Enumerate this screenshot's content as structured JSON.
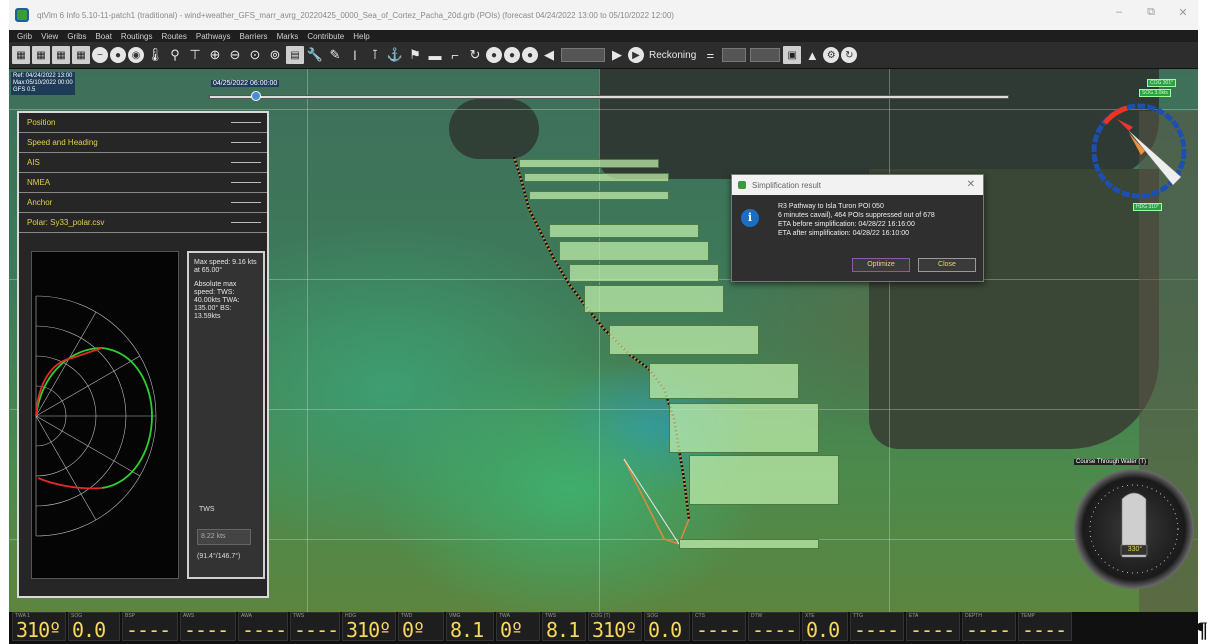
{
  "window": {
    "title": "qtVlm 6 Info 5.10-11-patch1 (traditional) - wind+weather_GFS_marr_avrg_20220425_0000_Sea_of_Cortez_Pacha_20d.grb (POIs) (forecast 04/24/2022 13:00 to 05/10/2022 12:00)",
    "minimize": "–",
    "maximize": "⧉",
    "close": "✕"
  },
  "menu": [
    "Grib",
    "View",
    "Gribs",
    "Boat",
    "Routings",
    "Routes",
    "Pathways",
    "Barriers",
    "Marks",
    "Contribute",
    "Help"
  ],
  "toolbar": {
    "reckoning_label": "Reckoning",
    "date_field": "",
    "step_field": "",
    "zoom_field": ""
  },
  "map_info": {
    "line1": "Ref: 04/24/2022 13:00",
    "line2": "Max:05/10/2022 00:00",
    "line3": "GFS 0.5",
    "timeline_date": "04/25/2022 06:00:00"
  },
  "dock": {
    "items": [
      "Position",
      "Speed and Heading",
      "AIS",
      "NMEA",
      "Anchor",
      "Polar: Sy33_polar.csv"
    ],
    "polar_info": {
      "max_speed": "Max speed: 9.16 kts at 65.00°",
      "absolute": "Absolute max speed: TWS: 40.00kts TWA: 135.00° BS: 13.59kts"
    },
    "tws_label": "TWS",
    "tws_value": "8.22 kts",
    "coords": "(91.4°/146.7°)"
  },
  "dialog": {
    "title": "Simplification result",
    "lines": [
      "R3 Pathway to Isla Turon POI 050",
      "6 minutes cavail), 464 POIs suppressed out of 678",
      "ETA before simplification: 04/28/22 16:16:00",
      "ETA after simplification: 04/28/22 16:10:00"
    ],
    "optimize_label": "Optimize",
    "close_label": "Close"
  },
  "gauge": {
    "title": "Course Through Water (T)",
    "readout": "330°"
  },
  "compass": {
    "tag1": "COG 301°",
    "tag2": "SOG 3.0kts",
    "tag3": "HDG 310°"
  },
  "instruments": [
    {
      "cap": "TWA 1",
      "val": "310º"
    },
    {
      "cap": "SOG",
      "val": "0.0"
    },
    {
      "cap": "BSP",
      "val": "----"
    },
    {
      "cap": "AWS",
      "val": "----"
    },
    {
      "cap": "AWA",
      "val": "----"
    },
    {
      "cap": "TWS",
      "val": "----"
    },
    {
      "cap": "HDG",
      "val": "310º"
    },
    {
      "cap": "TWD",
      "val": "0º"
    },
    {
      "cap": "VMG",
      "val": "8.1"
    },
    {
      "cap": "TWA",
      "val": "0º"
    },
    {
      "cap": "TWS",
      "val": "8.1"
    },
    {
      "cap": "COG (T)",
      "val": "310º"
    },
    {
      "cap": "SOG",
      "val": "0.0"
    },
    {
      "cap": "CTS",
      "val": "----"
    },
    {
      "cap": "DTW",
      "val": "----"
    },
    {
      "cap": "XTE",
      "val": "0.0"
    },
    {
      "cap": "TTG",
      "val": "----"
    },
    {
      "cap": "ETA",
      "val": "----"
    },
    {
      "cap": "DEPTH",
      "val": "----"
    },
    {
      "cap": "TEMP",
      "val": "----"
    }
  ],
  "colors": {
    "instrument_digits": "#f6d75a",
    "dock_text": "#e0d24a",
    "route": "#e08a3a",
    "polar_green": "#2fcf2f",
    "polar_red": "#e02a2a"
  }
}
